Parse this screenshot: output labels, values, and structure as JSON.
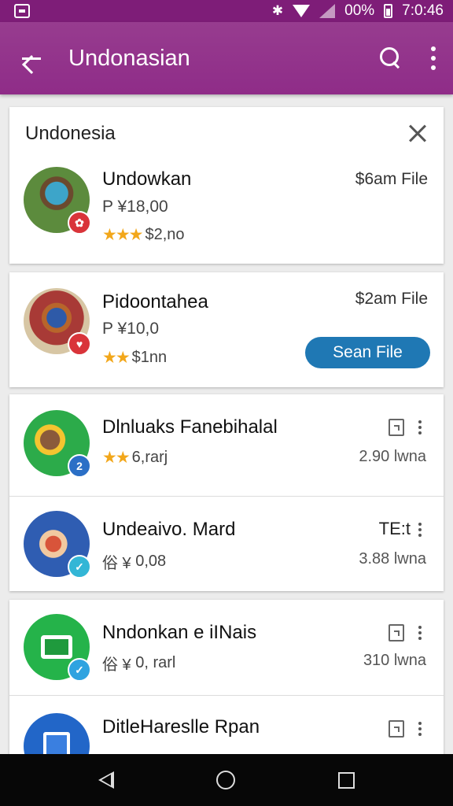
{
  "status_bar": {
    "battery_text": "00%",
    "time": "7:0:46",
    "icons": [
      "app-icon",
      "bluetooth-icon",
      "wifi-icon",
      "signal-icon",
      "battery-icon"
    ]
  },
  "app_bar": {
    "title": "Undonasian",
    "icons": [
      "back-arrow-icon",
      "search-icon",
      "overflow-menu-icon"
    ]
  },
  "colors": {
    "app_bar": "#8f2c88",
    "status_bar": "#7e1d78",
    "accent_button": "#1f78b4",
    "star": "#f2a71b",
    "nav_bar": "#070707"
  },
  "card1": {
    "header": "Undonesia",
    "item": {
      "title": "Undowkan",
      "subtitle": "P ¥18,00",
      "rating_text": "$2,no",
      "right_label": "$6am File",
      "star_count": 3
    }
  },
  "card2": {
    "item": {
      "title": "Pidoontahea",
      "subtitle": "P ¥10,0",
      "rating_text": "$1nn",
      "right_label": "$2am File",
      "button_label": "Sean File",
      "star_count": 2
    }
  },
  "card3": {
    "items": [
      {
        "title": "Dlnluaks Fanebihalal",
        "meta": "6,rarj",
        "right_bottom": "2.90 lwna",
        "star_count": 2,
        "badge": "2"
      },
      {
        "title": "Undeaivo. Mard",
        "meta": "0,08",
        "meta_prefix": "俗 ¥",
        "right_top": "TE:t",
        "right_bottom": "3.88 lwna"
      }
    ]
  },
  "card4": {
    "items": [
      {
        "title": "Nndonkan e iINais",
        "meta_prefix": "俗 ¥",
        "meta": "0, rarl",
        "right_bottom": "310 lwna"
      },
      {
        "title": "DitleHareslle Rpan"
      }
    ]
  },
  "nav": {
    "icons": [
      "nav-back-icon",
      "nav-home-icon",
      "nav-recent-icon"
    ]
  }
}
